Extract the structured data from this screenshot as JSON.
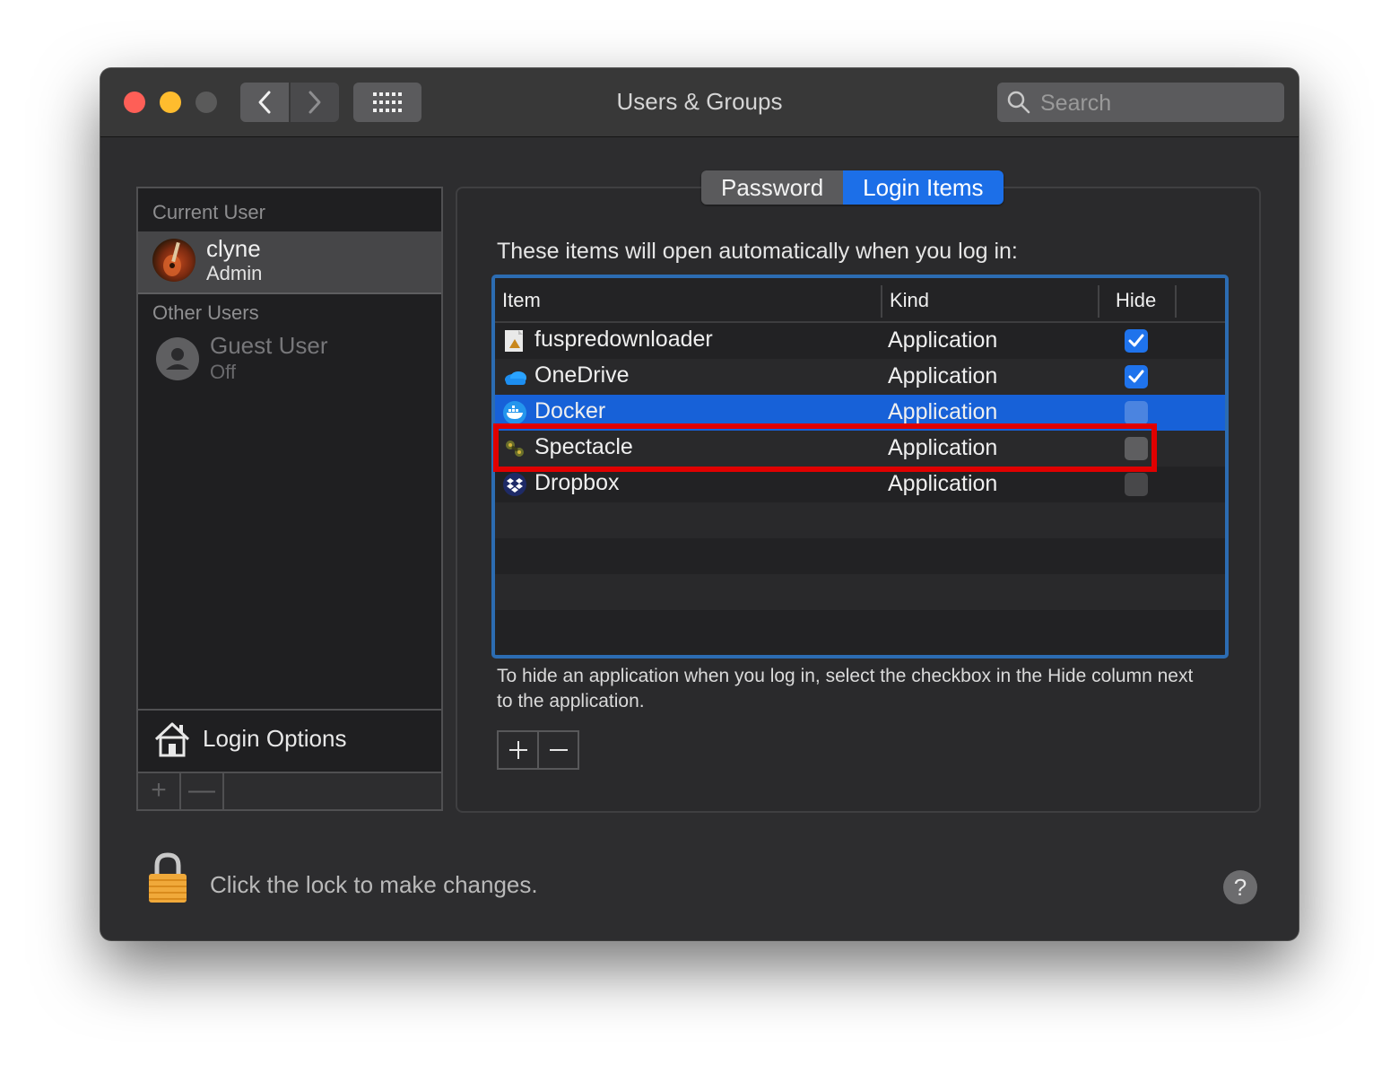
{
  "window": {
    "title": "Users & Groups",
    "search_placeholder": "Search"
  },
  "sidebar": {
    "current_user_header": "Current User",
    "current_user": {
      "name": "clyne",
      "role": "Admin"
    },
    "other_users_header": "Other Users",
    "other_users": [
      {
        "name": "Guest User",
        "status": "Off"
      }
    ],
    "login_options_label": "Login Options",
    "add_label": "+",
    "remove_label": "—"
  },
  "tabs": [
    {
      "label": "Password",
      "active": false
    },
    {
      "label": "Login Items",
      "active": true
    }
  ],
  "login_items": {
    "intro": "These items will open automatically when you log in:",
    "columns": {
      "item": "Item",
      "kind": "Kind",
      "hide": "Hide"
    },
    "rows": [
      {
        "name": "fuspredownloader",
        "kind": "Application",
        "hide": true,
        "icon": "script-app-icon"
      },
      {
        "name": "OneDrive",
        "kind": "Application",
        "hide": true,
        "icon": "onedrive-icon"
      },
      {
        "name": "Docker",
        "kind": "Application",
        "hide": false,
        "selected": true,
        "icon": "docker-icon"
      },
      {
        "name": "Spectacle",
        "kind": "Application",
        "hide": false,
        "highlighted": true,
        "icon": "spectacle-icon"
      },
      {
        "name": "Dropbox",
        "kind": "Application",
        "hide": false,
        "icon": "dropbox-icon"
      }
    ],
    "help_text": "To hide an application when you log in, select the checkbox in the Hide column next to the application.",
    "add_label": "+",
    "remove_label": "—"
  },
  "footer": {
    "lock_text": "Click the lock to make changes.",
    "help_label": "?"
  },
  "colors": {
    "accent": "#1c6fe8",
    "selection": "#1761d8",
    "highlight_box": "#e00000",
    "window_bg": "#2d2d2f"
  }
}
